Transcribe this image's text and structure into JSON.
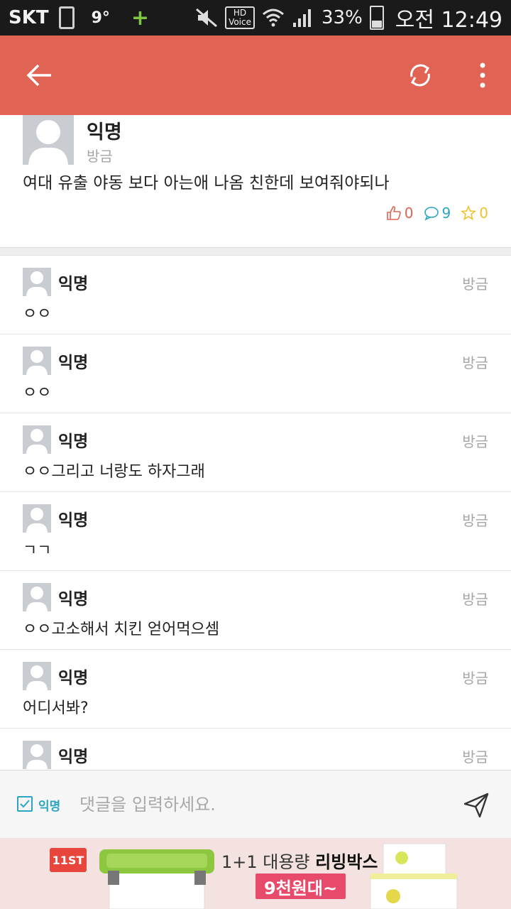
{
  "status_bar": {
    "carrier": "SKT",
    "temperature": "9°",
    "battery_percent": "33%",
    "time": "오전 12:49",
    "hd_label": "HD",
    "voice_label": "Voice"
  },
  "app_bar": {
    "color": "#e06353",
    "icons": [
      "back-arrow-icon",
      "refresh-icon",
      "more-vert-icon"
    ]
  },
  "post": {
    "author": "익명",
    "time": "방금",
    "body": "여대 유출 야동 보다 아는애 나옴 친한데 보여줘야되나",
    "likes": "0",
    "comments": "9",
    "scraps": "0"
  },
  "comments": [
    {
      "author": "익명",
      "time": "방금",
      "text": "ㅇㅇ"
    },
    {
      "author": "익명",
      "time": "방금",
      "text": "ㅇㅇ"
    },
    {
      "author": "익명",
      "time": "방금",
      "text": "ㅇㅇ그리고 너랑도 하자그래"
    },
    {
      "author": "익명",
      "time": "방금",
      "text": "ㄱㄱ"
    },
    {
      "author": "익명",
      "time": "방금",
      "text": "ㅇㅇ고소해서 치킨 얻어먹으셈"
    },
    {
      "author": "익명",
      "time": "방금",
      "text": "어디서봐?"
    },
    {
      "author": "익명",
      "time": "방금",
      "text": ""
    }
  ],
  "input_bar": {
    "anonymous_label": "익명",
    "anonymous_checked": true,
    "placeholder": "댓글을 입력하세요."
  },
  "ad": {
    "logo": "11ST",
    "headline_prefix": "1+1 대용량 ",
    "headline_bold": "리빙박스",
    "price": "9천원대~"
  }
}
